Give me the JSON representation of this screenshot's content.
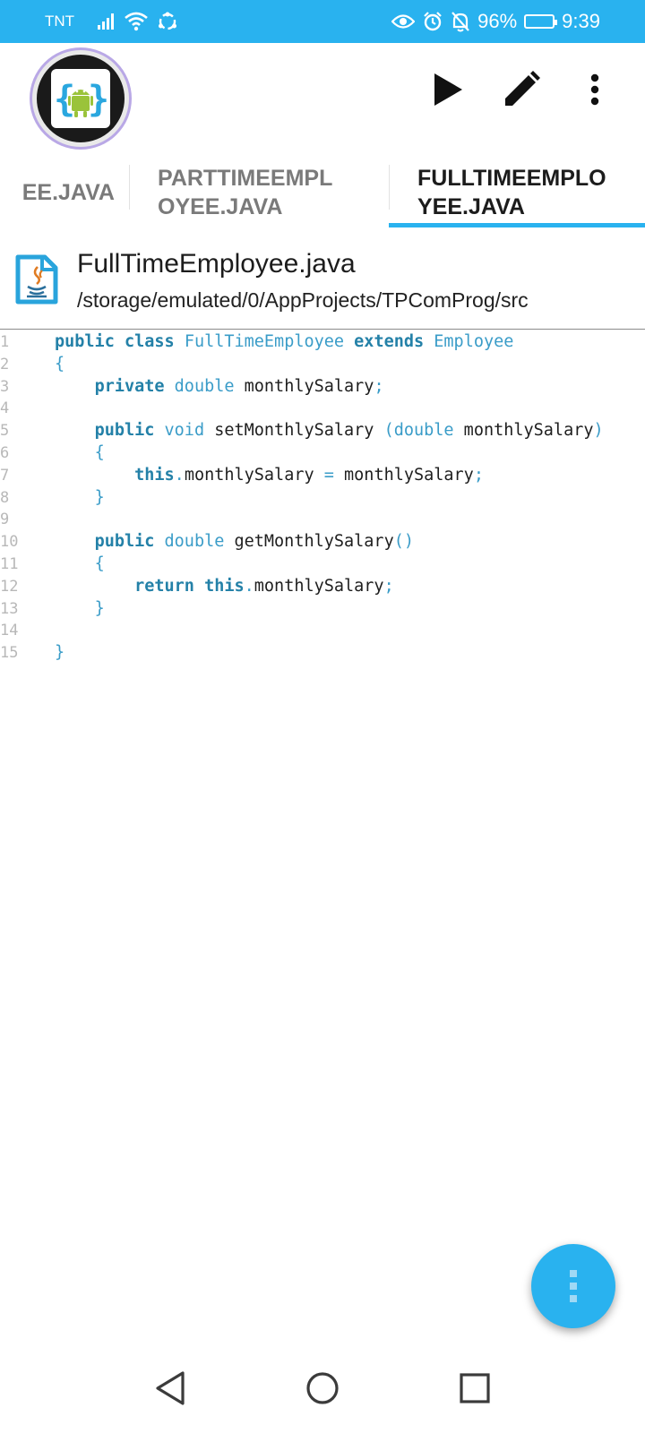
{
  "status_bar": {
    "carrier": "TNT",
    "battery": "96%",
    "time": "9:39"
  },
  "toolbar": {
    "app_logo": "android-code-logo",
    "actions": [
      "play-icon",
      "pencil-icon",
      "more-vertical-icon"
    ]
  },
  "tabs": [
    {
      "label": "EE.JAVA"
    },
    {
      "label": "PARTTIMEEMPL OYEE.JAVA"
    },
    {
      "label": "FULLTIMEEMPLO YEE.JAVA",
      "active": true
    }
  ],
  "file": {
    "name": "FullTimeEmployee.java",
    "path": "/storage/emulated/0/AppProjects/TPComProg/src",
    "icon": "java-file-icon"
  },
  "editor": {
    "line_numbers": [
      "1",
      "2",
      "3",
      "4",
      "5",
      "6",
      "7",
      "8",
      "9",
      "10",
      "11",
      "12",
      "13",
      "14",
      "15"
    ],
    "lines": [
      [
        {
          "t": "public",
          "c": "kw"
        },
        {
          "t": " "
        },
        {
          "t": "class",
          "c": "kw"
        },
        {
          "t": " "
        },
        {
          "t": "FullTimeEmployee",
          "c": "ty"
        },
        {
          "t": " "
        },
        {
          "t": "extends",
          "c": "kw"
        },
        {
          "t": " "
        },
        {
          "t": "Employee",
          "c": "ty"
        }
      ],
      [
        {
          "t": "{",
          "c": "pu"
        }
      ],
      [
        {
          "t": "    "
        },
        {
          "t": "private",
          "c": "kw"
        },
        {
          "t": " "
        },
        {
          "t": "double",
          "c": "ty"
        },
        {
          "t": " monthlySalary"
        },
        {
          "t": ";",
          "c": "pu"
        }
      ],
      [],
      [
        {
          "t": "    "
        },
        {
          "t": "public",
          "c": "kw"
        },
        {
          "t": " "
        },
        {
          "t": "void",
          "c": "ty"
        },
        {
          "t": " setMonthlySalary "
        },
        {
          "t": "(",
          "c": "pu"
        },
        {
          "t": "double",
          "c": "ty"
        },
        {
          "t": " monthlySalary"
        },
        {
          "t": ")",
          "c": "pu"
        }
      ],
      [
        {
          "t": "    "
        },
        {
          "t": "{",
          "c": "pu"
        }
      ],
      [
        {
          "t": "        "
        },
        {
          "t": "this",
          "c": "kw"
        },
        {
          "t": ".",
          "c": "pu"
        },
        {
          "t": "monthlySalary "
        },
        {
          "t": "=",
          "c": "pu"
        },
        {
          "t": " monthlySalary"
        },
        {
          "t": ";",
          "c": "pu"
        }
      ],
      [
        {
          "t": "    "
        },
        {
          "t": "}",
          "c": "pu"
        }
      ],
      [],
      [
        {
          "t": "    "
        },
        {
          "t": "public",
          "c": "kw"
        },
        {
          "t": " "
        },
        {
          "t": "double",
          "c": "ty"
        },
        {
          "t": " getMonthlySalary"
        },
        {
          "t": "()",
          "c": "pu"
        }
      ],
      [
        {
          "t": "    "
        },
        {
          "t": "{",
          "c": "pu"
        }
      ],
      [
        {
          "t": "        "
        },
        {
          "t": "return",
          "c": "kw"
        },
        {
          "t": " "
        },
        {
          "t": "this",
          "c": "kw"
        },
        {
          "t": ".",
          "c": "pu"
        },
        {
          "t": "monthlySalary"
        },
        {
          "t": ";",
          "c": "pu"
        }
      ],
      [
        {
          "t": "    "
        },
        {
          "t": "}",
          "c": "pu"
        }
      ],
      [],
      [
        {
          "t": "}",
          "c": "pu"
        }
      ]
    ]
  },
  "fab": {
    "icon": "more-vertical-icon"
  },
  "nav_bar": {
    "buttons": [
      "back-icon",
      "home-icon",
      "recents-icon"
    ]
  },
  "colors": {
    "accent": "#29b2ef",
    "keyword": "#2481a8",
    "type": "#3a9cc8"
  }
}
